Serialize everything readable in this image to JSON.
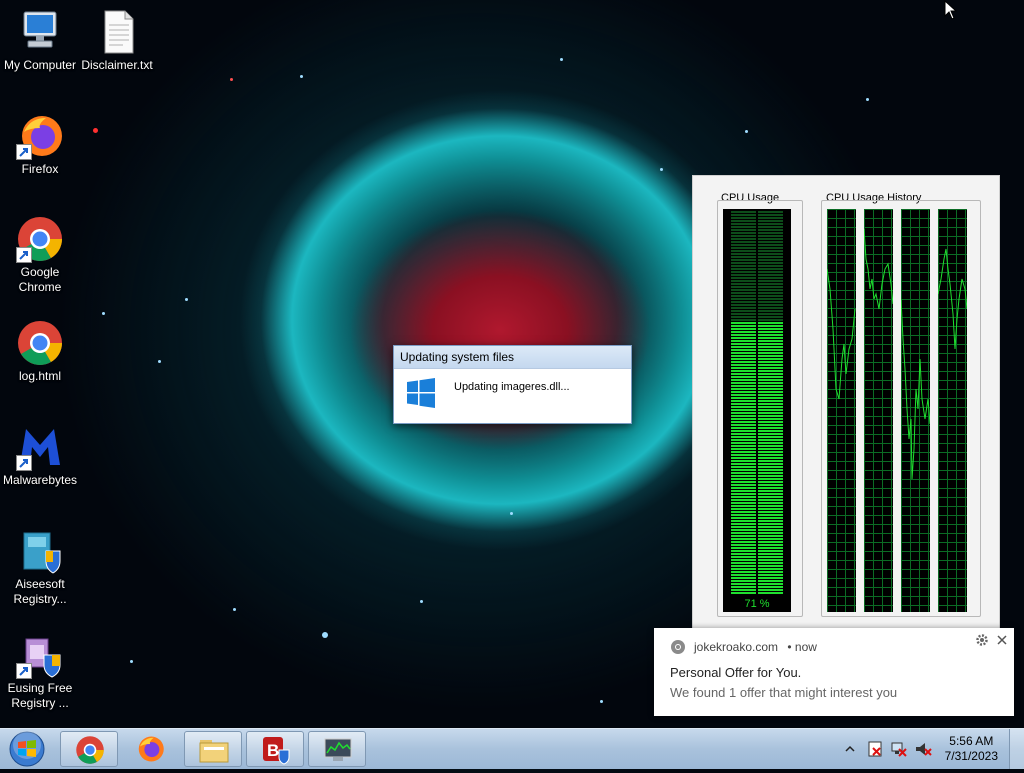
{
  "desktop": {
    "icons": [
      {
        "label": "My Computer"
      },
      {
        "label": "Disclaimer.txt"
      },
      {
        "label": "Firefox"
      },
      {
        "label": "Google Chrome"
      },
      {
        "label": "log.html"
      },
      {
        "label": "Malwarebytes"
      },
      {
        "label": "Aiseesoft Registry..."
      },
      {
        "label": "Eusing Free Registry ..."
      }
    ]
  },
  "dialog": {
    "title": "Updating system files",
    "message": "Updating imageres.dll..."
  },
  "cpu_widget": {
    "usage_label": "CPU Usage",
    "history_label": "CPU Usage History",
    "usage_percent_text": "71 %",
    "usage_fraction": 0.71
  },
  "notification": {
    "site": "jokekroako.com",
    "time": "• now",
    "title": "Personal Offer for You.",
    "body": "We found 1 offer that might interest you"
  },
  "taskbar": {
    "clock_time": "5:56 AM",
    "clock_date": "7/31/2023"
  },
  "colors": {
    "meter_green": "#1fe02f",
    "dialog_border": "#7a9cc5",
    "taskbar": "#a9c2dc"
  }
}
